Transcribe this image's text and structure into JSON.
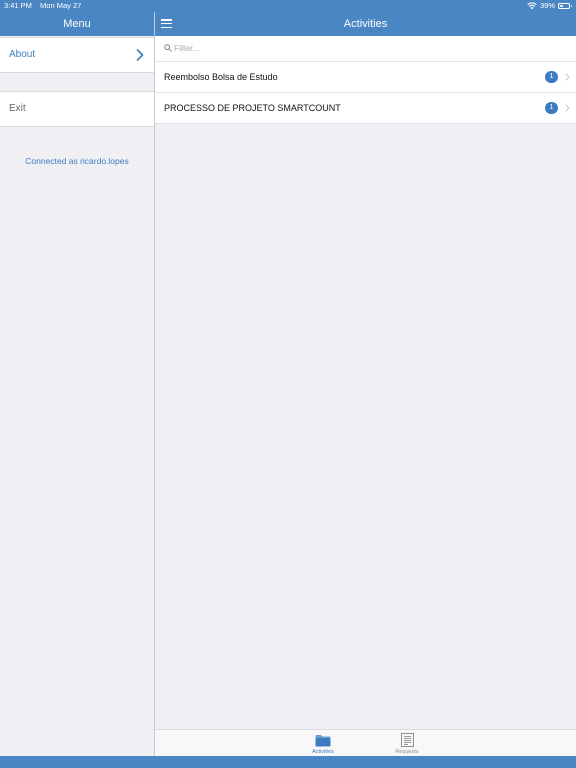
{
  "status_bar": {
    "time": "3:41 PM",
    "date": "Mon May 27",
    "battery_percent": "39%",
    "battery_level": 0.39
  },
  "menu": {
    "title": "Menu",
    "about_label": "About",
    "exit_label": "Exit",
    "connected_text": "Connected as ricardo.lopes"
  },
  "activities": {
    "title": "Activities",
    "filter_placeholder": "Filter...",
    "items": [
      {
        "label": "Reembolso Bolsa de Estudo",
        "count": "1"
      },
      {
        "label": "PROCESSO DE PROJETO SMARTCOUNT",
        "count": "1"
      }
    ]
  },
  "tabs": [
    {
      "label": "Activities",
      "icon": "folder-icon",
      "active": true
    },
    {
      "label": "Requests",
      "icon": "document-icon",
      "active": false
    }
  ],
  "colors": {
    "accent": "#4a86c3",
    "link": "#3d7cc0",
    "background": "#efeff4"
  }
}
